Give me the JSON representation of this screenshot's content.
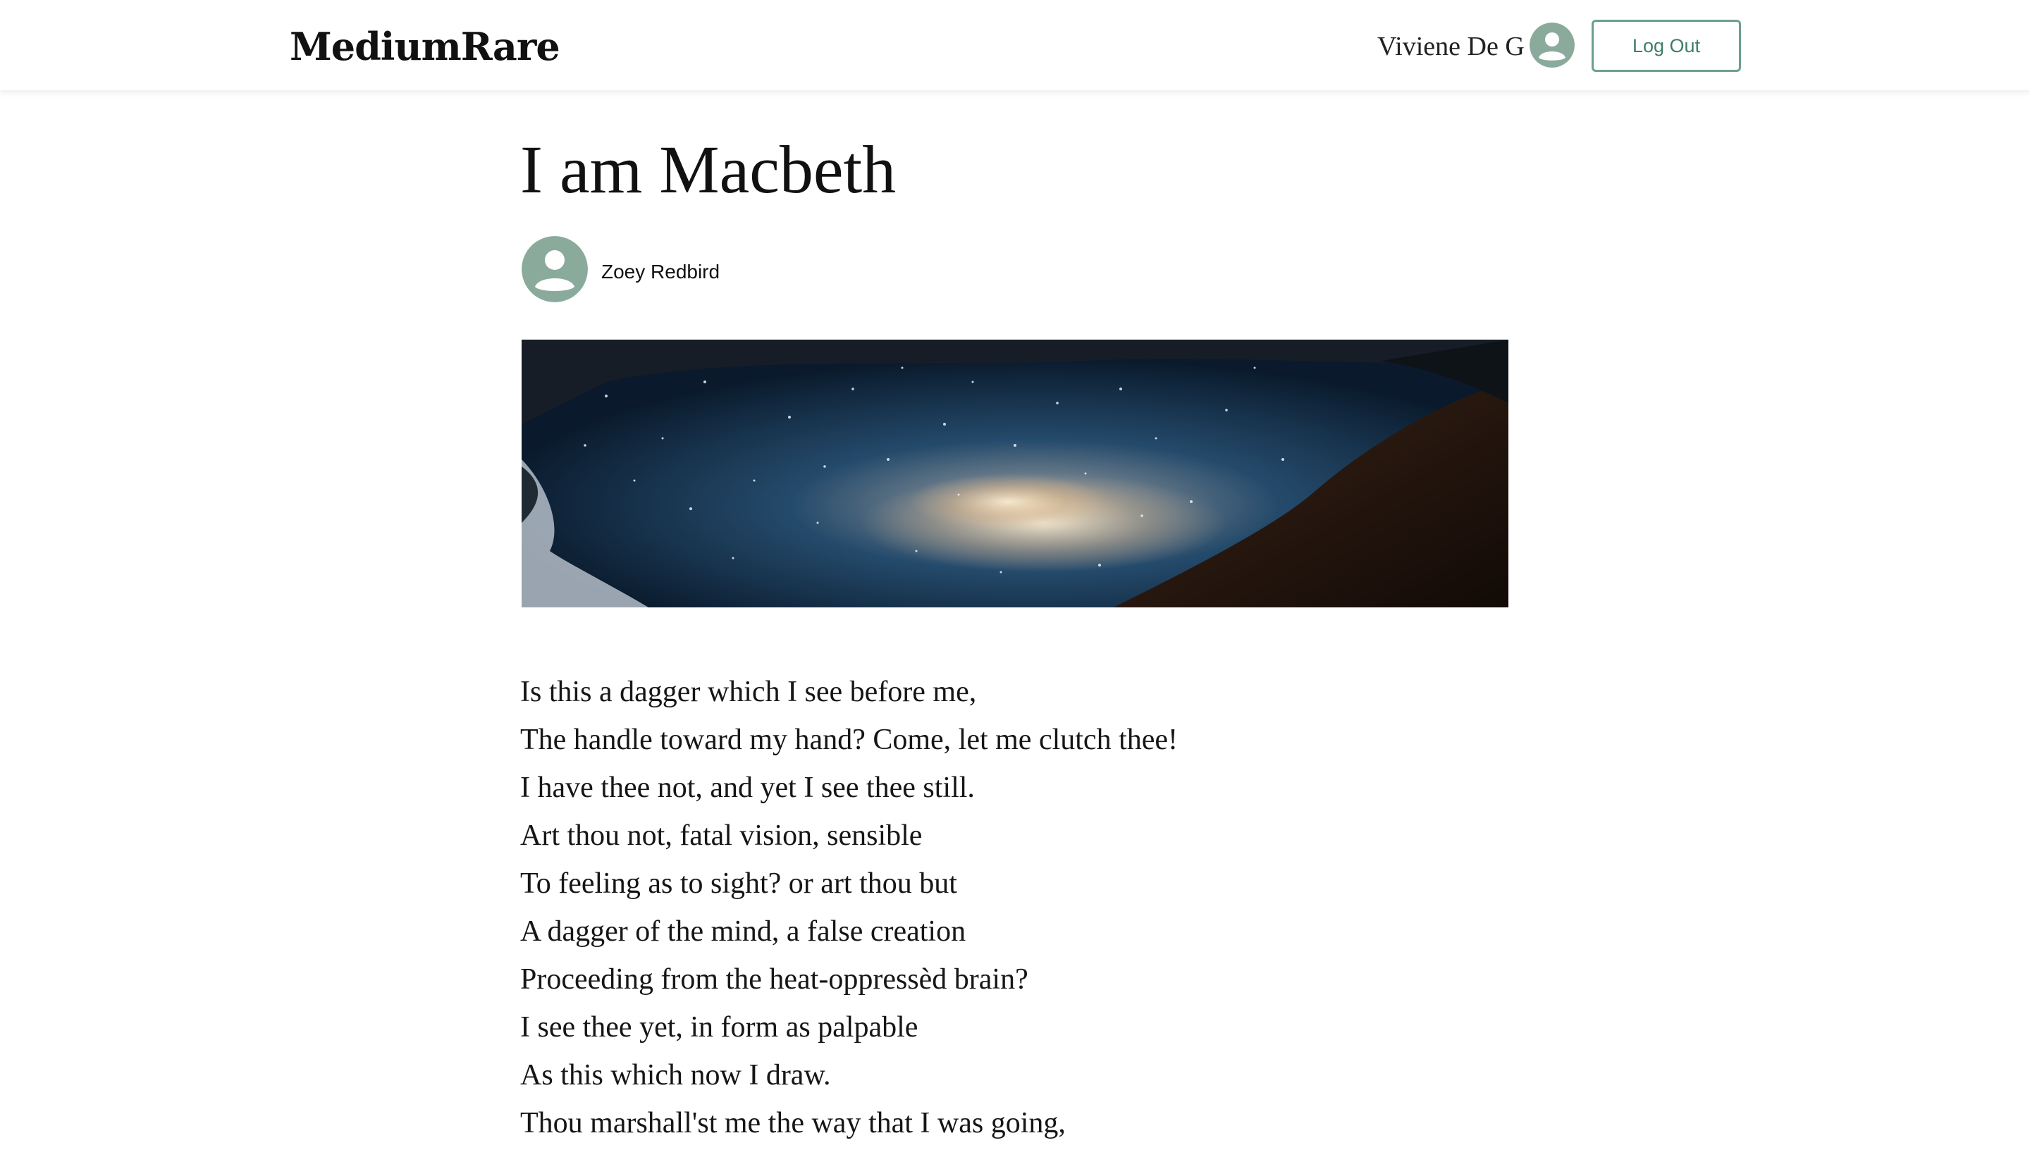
{
  "header": {
    "brand": "MediumRare",
    "user_name": "Viviene De G",
    "user_avatar_icon": "user-circle-icon",
    "logout_label": "Log Out"
  },
  "article": {
    "title": "I am Macbeth",
    "author": "Zoey Redbird",
    "author_avatar_icon": "user-circle-icon",
    "cover_image": "starry-night-reflection-pool",
    "lines": [
      "Is this a dagger which I see before me,",
      "The handle toward my hand? Come, let me clutch thee!",
      "I have thee not, and yet I see thee still.",
      "Art thou not, fatal vision, sensible",
      "To feeling as to sight? or art thou but",
      "A dagger of the mind, a false creation",
      "Proceeding from the heat-oppressèd brain?",
      "I see thee yet, in form as palpable",
      "As this which now I draw.",
      "Thou marshall'st me the way that I was going,"
    ]
  },
  "colors": {
    "accent": "#6ba08a",
    "avatar": "#8aab9c",
    "text": "#111111"
  }
}
